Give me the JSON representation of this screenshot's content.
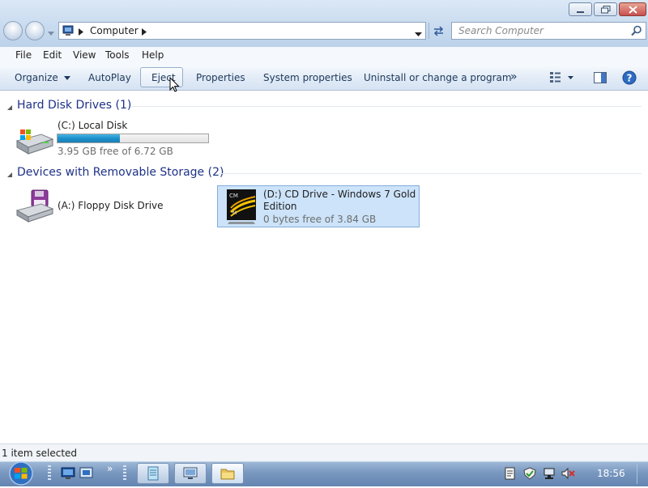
{
  "window": {
    "controls": {
      "minimize": "minimize",
      "maximize": "maximize",
      "close": "close"
    }
  },
  "address": {
    "path": [
      "Computer"
    ],
    "search_placeholder": "Search Computer"
  },
  "menu": [
    "File",
    "Edit",
    "View",
    "Tools",
    "Help"
  ],
  "commands": {
    "organize": "Organize",
    "autoplay": "AutoPlay",
    "eject": "Eject",
    "properties": "Properties",
    "system_properties": "System properties",
    "uninstall": "Uninstall or change a program",
    "more": "»"
  },
  "groups": {
    "hard_disks": {
      "header": "Hard Disk Drives (1)",
      "items": [
        {
          "label": "(C:) Local Disk",
          "free_text": "3.95 GB free of 6.72 GB",
          "used_fraction": 0.412,
          "icon": "hard-disk-icon"
        }
      ]
    },
    "removable": {
      "header": "Devices with Removable Storage (2)",
      "floppy": {
        "label": "(A:) Floppy Disk Drive",
        "icon": "floppy-drive-icon"
      },
      "cd": {
        "label_line1": "(D:) CD Drive - Windows 7 Gold",
        "label_line2": "Edition",
        "free_text": "0 bytes free of 3.84 GB",
        "icon": "cd-drive-icon"
      }
    }
  },
  "status": {
    "text": "1 item selected"
  },
  "taskbar": {
    "time": "18:56"
  },
  "colors": {
    "selection": "#cce3f9",
    "usage_bar": "#26a0da",
    "group_header": "#1e3287"
  }
}
